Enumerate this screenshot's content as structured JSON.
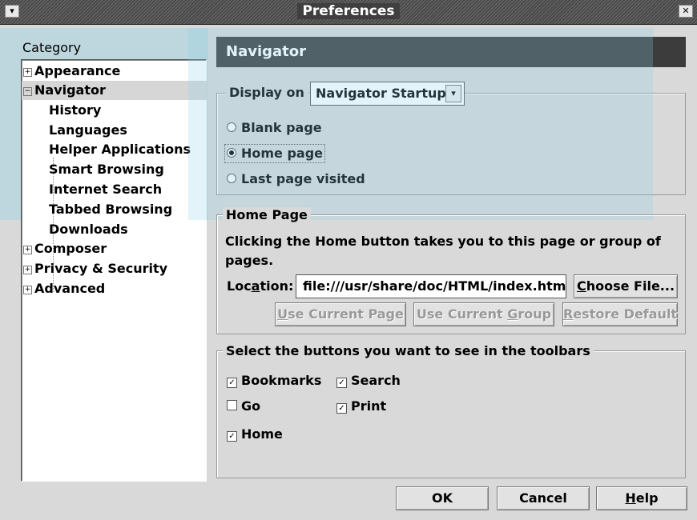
{
  "window": {
    "title": "Preferences",
    "menu_icon": "chevron-down-icon",
    "close_icon": "close-icon"
  },
  "sidebar": {
    "label": "Category",
    "items": [
      {
        "label": "Appearance",
        "expander": "+",
        "level": 0
      },
      {
        "label": "Navigator",
        "expander": "−",
        "level": 0,
        "selected": true
      },
      {
        "label": "History",
        "level": 1
      },
      {
        "label": "Languages",
        "level": 1
      },
      {
        "label": "Helper Applications",
        "level": 1
      },
      {
        "label": "Smart Browsing",
        "level": 1
      },
      {
        "label": "Internet Search",
        "level": 1
      },
      {
        "label": "Tabbed Browsing",
        "level": 1
      },
      {
        "label": "Downloads",
        "level": 1
      },
      {
        "label": "Composer",
        "expander": "+",
        "level": 0
      },
      {
        "label": "Privacy & Security",
        "expander": "+",
        "level": 0
      },
      {
        "label": "Advanced",
        "expander": "+",
        "level": 0
      }
    ]
  },
  "panel": {
    "title": "Navigator",
    "display_on": {
      "label": "Display on",
      "selected": "Navigator Startup"
    },
    "startup": {
      "options": [
        {
          "label": "Blank page",
          "checked": false
        },
        {
          "label": "Home page",
          "checked": true
        },
        {
          "label": "Last page visited",
          "checked": false
        }
      ]
    },
    "home_page": {
      "title": "Home Page",
      "description": "Clicking the Home button takes you to this page or group of pages.",
      "location_label_pre": "Loc",
      "location_label_u": "a",
      "location_label_post": "tion:",
      "location_value": "file:///usr/share/doc/HTML/index.html",
      "choose_pre": "",
      "choose_u": "C",
      "choose_post": "hoose File...",
      "use_current_page_u": "U",
      "use_current_page_post": "se Current Page",
      "use_current_group_pre": "Use Current ",
      "use_current_group_u": "G",
      "use_current_group_post": "roup",
      "restore_u": "R",
      "restore_post": "estore Default"
    },
    "toolbars": {
      "title": "Select the buttons you want to see in the toolbars",
      "items": [
        {
          "label": "Bookmarks",
          "checked": true
        },
        {
          "label": "Search",
          "checked": true
        },
        {
          "label": "Go",
          "checked": false
        },
        {
          "label": "Print",
          "checked": true
        },
        {
          "label": "Home",
          "checked": true
        }
      ]
    }
  },
  "footer": {
    "ok": "OK",
    "cancel": "Cancel",
    "help_u": "H",
    "help_post": "elp"
  }
}
